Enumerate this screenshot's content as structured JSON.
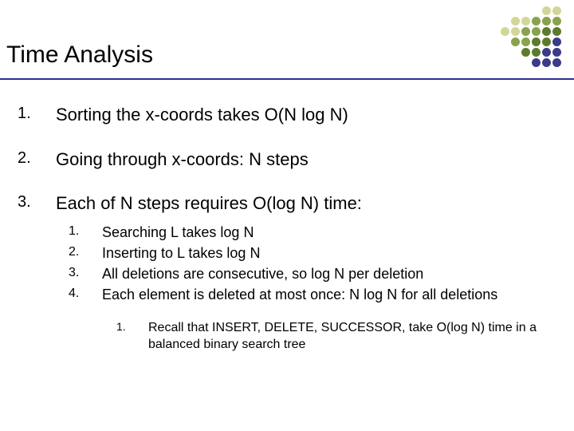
{
  "title": "Time Analysis",
  "points": [
    {
      "num": "1.",
      "text": "Sorting the x-coords takes O(N log N)"
    },
    {
      "num": "2.",
      "text": "Going through x-coords: N steps"
    },
    {
      "num": "3.",
      "text": "Each of N steps requires O(log N) time:"
    }
  ],
  "sub": [
    {
      "num": "1.",
      "text": "Searching L takes log N"
    },
    {
      "num": "2.",
      "text": "Inserting to L takes log N"
    },
    {
      "num": "3.",
      "text": "All deletions are consecutive, so log N per deletion"
    },
    {
      "num": "4.",
      "text": "Each element is deleted at most once: N log N for all deletions"
    }
  ],
  "subsub": [
    {
      "num": "1.",
      "text": "Recall that INSERT, DELETE, SUCCESSOR, take O(log N) time in a balanced binary search tree"
    }
  ]
}
